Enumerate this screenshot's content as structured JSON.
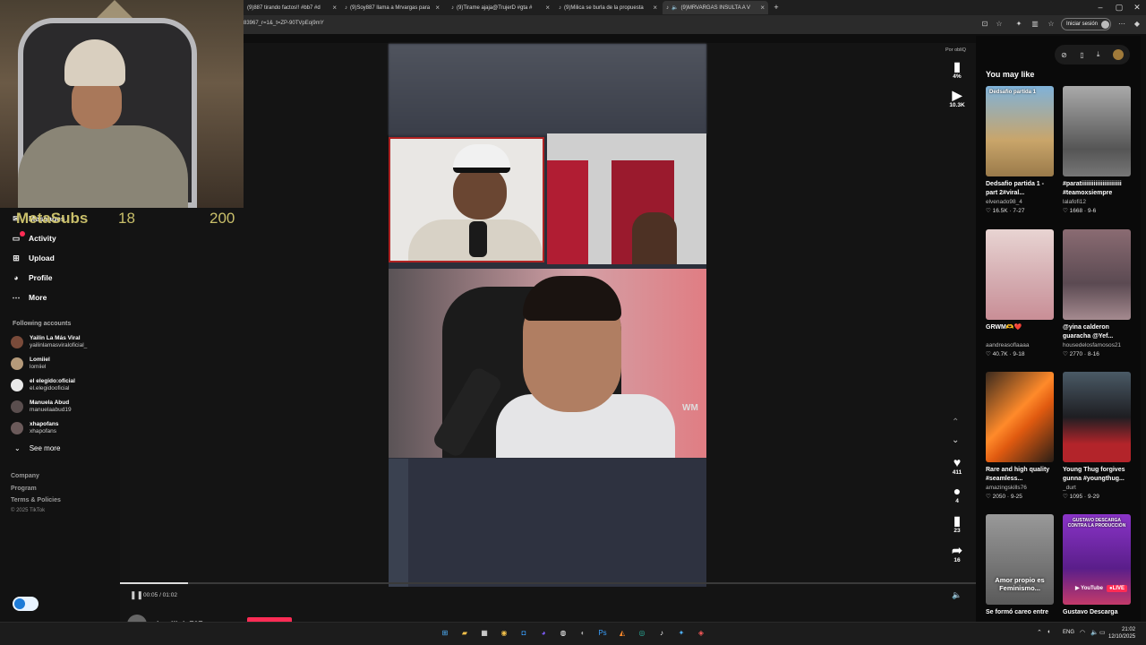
{
  "browser": {
    "tabs": [
      {
        "label": "(9)887 tirando factos!! #bb7 #d",
        "active": false
      },
      {
        "label": "(9)Soy887 llama a Mrvargas para",
        "active": false
      },
      {
        "label": "(9)Tirame ajaja@TrujerD #gta #",
        "active": false
      },
      {
        "label": "(9)Milica se burla de la propuesta",
        "active": false
      },
      {
        "label": "(9)MRVARGAS INSULTA A V",
        "active": true
      }
    ],
    "new_tab": "+",
    "url": "83967_r=1&_t=ZP-90TVpEoj9mY",
    "signin_label": "Iniciar sesión"
  },
  "stream_overlay": {
    "subs_label": "MetaSubs",
    "subs_count": "18",
    "subs_goal": "200"
  },
  "sidebar": {
    "nav": [
      {
        "label": "Messages",
        "icon": "message-icon"
      },
      {
        "label": "Activity",
        "icon": "activity-icon"
      },
      {
        "label": "Upload",
        "icon": "upload-icon"
      },
      {
        "label": "Profile",
        "icon": "profile-icon"
      },
      {
        "label": "More",
        "icon": "more-icon"
      }
    ],
    "following_title": "Following accounts",
    "following": [
      {
        "name": "Yailin La Más Viral",
        "handle": "yailinlamasviraloficial_"
      },
      {
        "name": "Lomiiel",
        "handle": "lomiiel"
      },
      {
        "name": "el elegido:oficial",
        "handle": "el.elegidooficial"
      },
      {
        "name": "Manuela Abud",
        "handle": "manuelaabud19"
      },
      {
        "name": "xhapofans",
        "handle": "xhapofans"
      }
    ],
    "see_more": "See more",
    "footer": [
      "Company",
      "Program",
      "Terms & Policies"
    ],
    "copyright": "© 2025 TikTok"
  },
  "player": {
    "time": "00:05 / 01:02",
    "progress": 0.08,
    "author": "domiilol_707",
    "watermark": "WM",
    "brand_tag": "Por obliQ",
    "stats": {
      "views_pct": "4%",
      "plays": "10.3K",
      "likes": "411",
      "comments": "4",
      "saves": "23",
      "shares": "16"
    }
  },
  "recommendations": {
    "title": "You may like",
    "items": [
      {
        "title": "Dedsafio partida 1 - part 2#viral...",
        "user": "elvenado98_4",
        "likes": "16.5K",
        "date": "7-27",
        "thumb_text": "Dedsafio partida 1",
        "color": "#6aa0c8"
      },
      {
        "title": "#paratiiiiiiiiiiiiiiiiiiiiiii #teamoxsiempre",
        "user": "lalafofi12",
        "likes": "1668",
        "date": "9-6",
        "thumb_text": "",
        "color": "#8d8d8d"
      },
      {
        "title": "GRWM🫶❤️",
        "user": "aandreasoflaaaa",
        "likes": "40.7K",
        "date": "9-18",
        "thumb_text": "",
        "color": "#d9b6b8"
      },
      {
        "title": "@yina calderon guaracha @Yef...",
        "user": "housedelosfamosos21",
        "likes": "2770",
        "date": "8-16",
        "thumb_text": "",
        "color": "#7b5c63"
      },
      {
        "title": "Rare and high quality #seamless...",
        "user": "amazingskills76",
        "likes": "2050",
        "date": "9-25",
        "thumb_text": "",
        "color": "#d96a1f"
      },
      {
        "title": "Young Thug forgives gunna #youngthug...",
        "user": "_durt",
        "likes": "1095",
        "date": "9-29",
        "thumb_text": "",
        "color": "#4a5560"
      },
      {
        "title": "Se formó careo entre",
        "user": "",
        "likes": "",
        "date": "",
        "thumb_text": "Amor propio es Feminismo...",
        "color": "#8a8a8a"
      },
      {
        "title": "Gustavo Descarga",
        "user": "",
        "likes": "",
        "date": "",
        "thumb_text": "GUSTAVO DESCARGA CONTRA LA PRODUCCIÓN",
        "color": "#7a2aa8"
      }
    ]
  },
  "taskbar": {
    "lang": "ENG",
    "time": "21:02",
    "date": "12/10/2025"
  }
}
